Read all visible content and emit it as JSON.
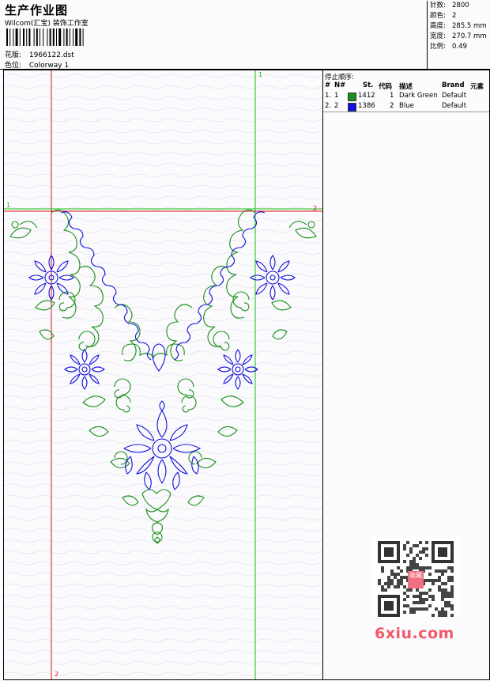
{
  "header": {
    "title": "生产作业图",
    "company": "Wilcom(汇宝) 装饰工作室",
    "design_label": "花版:",
    "design_value": "1966122.dst",
    "colorway_label": "色位:",
    "colorway_value": "Colorway 1"
  },
  "stats": [
    {
      "label": "针数:",
      "value": "2800"
    },
    {
      "label": "颜色:",
      "value": "2"
    },
    {
      "label": "高度:",
      "value": "285.5 mm"
    },
    {
      "label": "宽度:",
      "value": "270.7 mm"
    },
    {
      "label": "比例:",
      "value": "0.49"
    }
  ],
  "stop_sequence": {
    "title": "停止顺序:",
    "columns": [
      "#",
      "N#",
      "St.",
      "代码",
      "描述",
      "Brand",
      "元素"
    ],
    "rows": [
      {
        "num": "1.",
        "needle": "1",
        "color": "#1a8f1a",
        "stitches": "1412",
        "code": "1",
        "description": "Dark Green",
        "brand": "Default"
      },
      {
        "num": "2.",
        "needle": "2",
        "color": "#1010e0",
        "stitches": "1386",
        "code": "2",
        "description": "Blue",
        "brand": "Default"
      }
    ]
  },
  "guides": {
    "vertical_red_label": "2",
    "vertical_green_label": "1",
    "horizontal_green_label": "1",
    "horizontal_red_label": "2"
  },
  "watermark": {
    "text": "6xiu.com",
    "stamp": "收藏"
  },
  "colors": {
    "thread_green": "#1a8f1a",
    "thread_blue": "#1010e0",
    "guide_red": "#e01010",
    "guide_green": "#10c010"
  }
}
